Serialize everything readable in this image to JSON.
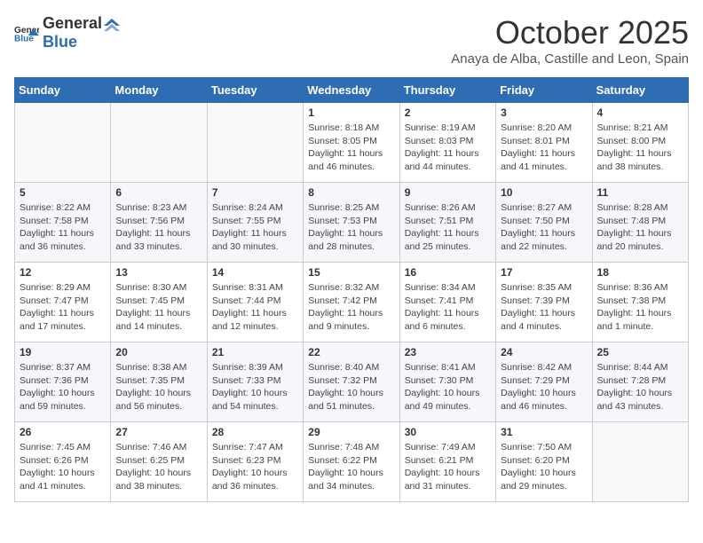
{
  "header": {
    "logo_general": "General",
    "logo_blue": "Blue",
    "month_title": "October 2025",
    "subtitle": "Anaya de Alba, Castille and Leon, Spain"
  },
  "weekdays": [
    "Sunday",
    "Monday",
    "Tuesday",
    "Wednesday",
    "Thursday",
    "Friday",
    "Saturday"
  ],
  "weeks": [
    [
      {
        "day": "",
        "sunrise": "",
        "sunset": "",
        "daylight": ""
      },
      {
        "day": "",
        "sunrise": "",
        "sunset": "",
        "daylight": ""
      },
      {
        "day": "",
        "sunrise": "",
        "sunset": "",
        "daylight": ""
      },
      {
        "day": "1",
        "sunrise": "Sunrise: 8:18 AM",
        "sunset": "Sunset: 8:05 PM",
        "daylight": "Daylight: 11 hours and 46 minutes."
      },
      {
        "day": "2",
        "sunrise": "Sunrise: 8:19 AM",
        "sunset": "Sunset: 8:03 PM",
        "daylight": "Daylight: 11 hours and 44 minutes."
      },
      {
        "day": "3",
        "sunrise": "Sunrise: 8:20 AM",
        "sunset": "Sunset: 8:01 PM",
        "daylight": "Daylight: 11 hours and 41 minutes."
      },
      {
        "day": "4",
        "sunrise": "Sunrise: 8:21 AM",
        "sunset": "Sunset: 8:00 PM",
        "daylight": "Daylight: 11 hours and 38 minutes."
      }
    ],
    [
      {
        "day": "5",
        "sunrise": "Sunrise: 8:22 AM",
        "sunset": "Sunset: 7:58 PM",
        "daylight": "Daylight: 11 hours and 36 minutes."
      },
      {
        "day": "6",
        "sunrise": "Sunrise: 8:23 AM",
        "sunset": "Sunset: 7:56 PM",
        "daylight": "Daylight: 11 hours and 33 minutes."
      },
      {
        "day": "7",
        "sunrise": "Sunrise: 8:24 AM",
        "sunset": "Sunset: 7:55 PM",
        "daylight": "Daylight: 11 hours and 30 minutes."
      },
      {
        "day": "8",
        "sunrise": "Sunrise: 8:25 AM",
        "sunset": "Sunset: 7:53 PM",
        "daylight": "Daylight: 11 hours and 28 minutes."
      },
      {
        "day": "9",
        "sunrise": "Sunrise: 8:26 AM",
        "sunset": "Sunset: 7:51 PM",
        "daylight": "Daylight: 11 hours and 25 minutes."
      },
      {
        "day": "10",
        "sunrise": "Sunrise: 8:27 AM",
        "sunset": "Sunset: 7:50 PM",
        "daylight": "Daylight: 11 hours and 22 minutes."
      },
      {
        "day": "11",
        "sunrise": "Sunrise: 8:28 AM",
        "sunset": "Sunset: 7:48 PM",
        "daylight": "Daylight: 11 hours and 20 minutes."
      }
    ],
    [
      {
        "day": "12",
        "sunrise": "Sunrise: 8:29 AM",
        "sunset": "Sunset: 7:47 PM",
        "daylight": "Daylight: 11 hours and 17 minutes."
      },
      {
        "day": "13",
        "sunrise": "Sunrise: 8:30 AM",
        "sunset": "Sunset: 7:45 PM",
        "daylight": "Daylight: 11 hours and 14 minutes."
      },
      {
        "day": "14",
        "sunrise": "Sunrise: 8:31 AM",
        "sunset": "Sunset: 7:44 PM",
        "daylight": "Daylight: 11 hours and 12 minutes."
      },
      {
        "day": "15",
        "sunrise": "Sunrise: 8:32 AM",
        "sunset": "Sunset: 7:42 PM",
        "daylight": "Daylight: 11 hours and 9 minutes."
      },
      {
        "day": "16",
        "sunrise": "Sunrise: 8:34 AM",
        "sunset": "Sunset: 7:41 PM",
        "daylight": "Daylight: 11 hours and 6 minutes."
      },
      {
        "day": "17",
        "sunrise": "Sunrise: 8:35 AM",
        "sunset": "Sunset: 7:39 PM",
        "daylight": "Daylight: 11 hours and 4 minutes."
      },
      {
        "day": "18",
        "sunrise": "Sunrise: 8:36 AM",
        "sunset": "Sunset: 7:38 PM",
        "daylight": "Daylight: 11 hours and 1 minute."
      }
    ],
    [
      {
        "day": "19",
        "sunrise": "Sunrise: 8:37 AM",
        "sunset": "Sunset: 7:36 PM",
        "daylight": "Daylight: 10 hours and 59 minutes."
      },
      {
        "day": "20",
        "sunrise": "Sunrise: 8:38 AM",
        "sunset": "Sunset: 7:35 PM",
        "daylight": "Daylight: 10 hours and 56 minutes."
      },
      {
        "day": "21",
        "sunrise": "Sunrise: 8:39 AM",
        "sunset": "Sunset: 7:33 PM",
        "daylight": "Daylight: 10 hours and 54 minutes."
      },
      {
        "day": "22",
        "sunrise": "Sunrise: 8:40 AM",
        "sunset": "Sunset: 7:32 PM",
        "daylight": "Daylight: 10 hours and 51 minutes."
      },
      {
        "day": "23",
        "sunrise": "Sunrise: 8:41 AM",
        "sunset": "Sunset: 7:30 PM",
        "daylight": "Daylight: 10 hours and 49 minutes."
      },
      {
        "day": "24",
        "sunrise": "Sunrise: 8:42 AM",
        "sunset": "Sunset: 7:29 PM",
        "daylight": "Daylight: 10 hours and 46 minutes."
      },
      {
        "day": "25",
        "sunrise": "Sunrise: 8:44 AM",
        "sunset": "Sunset: 7:28 PM",
        "daylight": "Daylight: 10 hours and 43 minutes."
      }
    ],
    [
      {
        "day": "26",
        "sunrise": "Sunrise: 7:45 AM",
        "sunset": "Sunset: 6:26 PM",
        "daylight": "Daylight: 10 hours and 41 minutes."
      },
      {
        "day": "27",
        "sunrise": "Sunrise: 7:46 AM",
        "sunset": "Sunset: 6:25 PM",
        "daylight": "Daylight: 10 hours and 38 minutes."
      },
      {
        "day": "28",
        "sunrise": "Sunrise: 7:47 AM",
        "sunset": "Sunset: 6:23 PM",
        "daylight": "Daylight: 10 hours and 36 minutes."
      },
      {
        "day": "29",
        "sunrise": "Sunrise: 7:48 AM",
        "sunset": "Sunset: 6:22 PM",
        "daylight": "Daylight: 10 hours and 34 minutes."
      },
      {
        "day": "30",
        "sunrise": "Sunrise: 7:49 AM",
        "sunset": "Sunset: 6:21 PM",
        "daylight": "Daylight: 10 hours and 31 minutes."
      },
      {
        "day": "31",
        "sunrise": "Sunrise: 7:50 AM",
        "sunset": "Sunset: 6:20 PM",
        "daylight": "Daylight: 10 hours and 29 minutes."
      },
      {
        "day": "",
        "sunrise": "",
        "sunset": "",
        "daylight": ""
      }
    ]
  ]
}
